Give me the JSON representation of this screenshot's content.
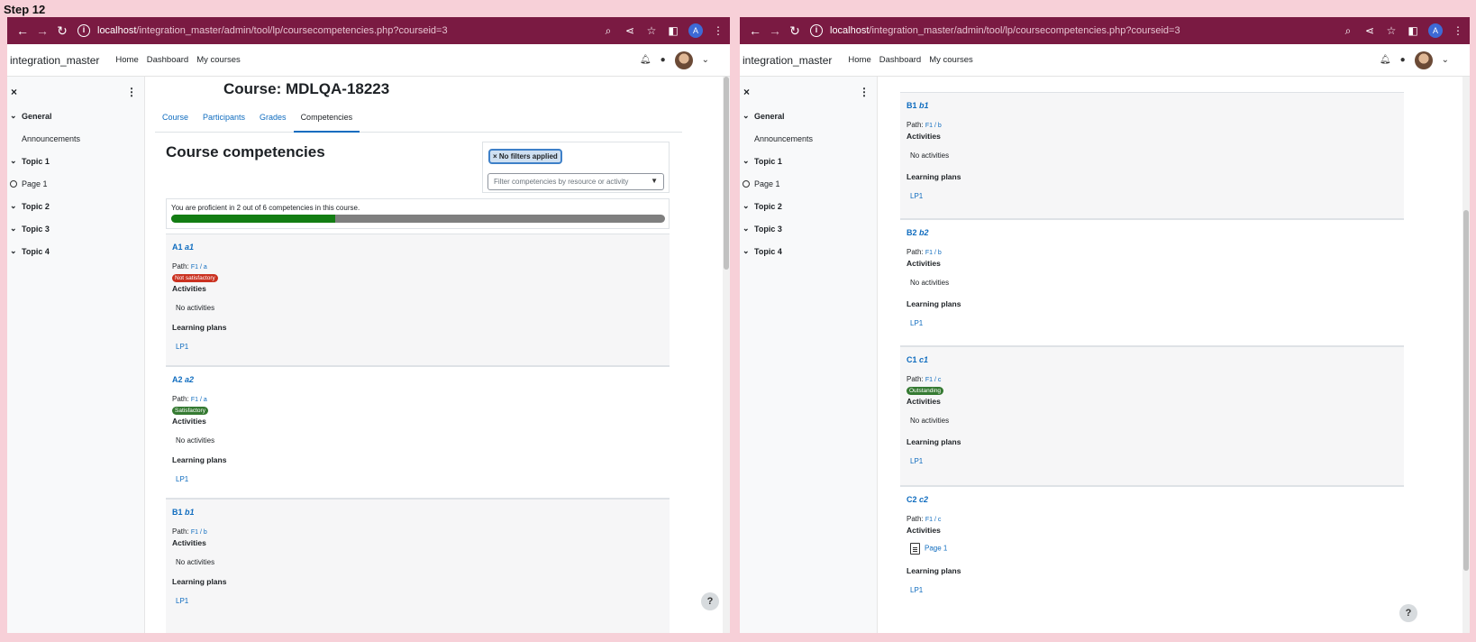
{
  "step_label": "Step 12",
  "browser": {
    "url_host": "localhost",
    "url_path": "/integration_master/admin/tool/lp/coursecompetencies.php?courseid=3",
    "profile_initial": "A"
  },
  "site": {
    "name": "integration_master",
    "nav": [
      "Home",
      "Dashboard",
      "My courses"
    ]
  },
  "sidebar": {
    "close_label": "×",
    "more_label": "⋮",
    "items": [
      {
        "label": "General",
        "type": "section"
      },
      {
        "label": "Announcements",
        "type": "sub"
      },
      {
        "label": "Topic 1",
        "type": "section"
      },
      {
        "label": "Page 1",
        "type": "page"
      },
      {
        "label": "Topic 2",
        "type": "section"
      },
      {
        "label": "Topic 3",
        "type": "section"
      },
      {
        "label": "Topic 4",
        "type": "section"
      }
    ]
  },
  "course": {
    "title": "Course: MDLQA-18223",
    "tabs": [
      "Course",
      "Participants",
      "Grades",
      "Competencies"
    ],
    "active_tab": "Competencies",
    "heading": "Course competencies",
    "filter_pill": "× No filters applied",
    "filter_placeholder": "Filter competencies by resource or activity",
    "progress_text": "You are proficient in 2 out of 6 competencies in this course.",
    "progress_fraction": 0.333
  },
  "labels": {
    "path": "Path: ",
    "activities": "Activities",
    "learning_plans": "Learning plans",
    "no_activities": "No activities"
  },
  "competencies": [
    {
      "name": "A1",
      "idnumber": "a1",
      "path": "F1 / a",
      "rating": "Not satisfactory",
      "rating_color": "#ca3120",
      "activities": "No activities",
      "plan": "LP1"
    },
    {
      "name": "A2",
      "idnumber": "a2",
      "path": "F1 / a",
      "rating": "Satisfactory",
      "rating_color": "#357a32",
      "activities": "No activities",
      "plan": "LP1"
    },
    {
      "name": "B1",
      "idnumber": "b1",
      "path": "F1 / b",
      "rating": "",
      "activities": "No activities",
      "plan": "LP1"
    },
    {
      "name": "B2",
      "idnumber": "b2",
      "path": "F1 / b",
      "rating": "",
      "activities": "No activities",
      "plan": "LP1"
    },
    {
      "name": "C1",
      "idnumber": "c1",
      "path": "F1 / c",
      "rating": "Outstanding",
      "rating_color": "#357a32",
      "activities": "No activities",
      "plan": "LP1"
    },
    {
      "name": "C2",
      "idnumber": "c2",
      "path": "F1 / c",
      "rating": "",
      "activities": "Page 1",
      "activity_icon": "page-icon",
      "plan": "LP1"
    }
  ],
  "help_label": "?"
}
